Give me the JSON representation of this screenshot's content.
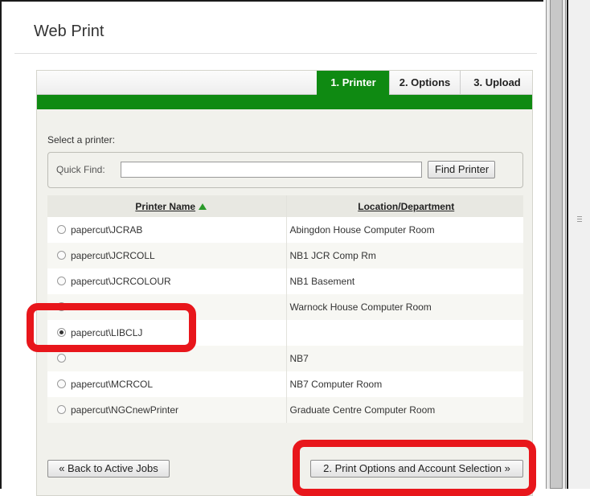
{
  "page": {
    "title": "Web Print"
  },
  "tabs": [
    {
      "label": "1. Printer",
      "active": true
    },
    {
      "label": "2. Options",
      "active": false
    },
    {
      "label": "3. Upload",
      "active": false
    }
  ],
  "colors": {
    "accent": "#0f8a12",
    "annotation": "#e8161b",
    "sort_arrow": "#2a9a2a"
  },
  "select_label": "Select a printer:",
  "quick_find": {
    "label": "Quick Find:",
    "value": "",
    "placeholder": "",
    "button_label": "Find Printer"
  },
  "table": {
    "headers": {
      "name": "Printer Name",
      "location": "Location/Department"
    },
    "sort_icon": "sort-ascending-icon",
    "rows": [
      {
        "name": "papercut\\JCRAB",
        "location": "Abingdon House Computer Room",
        "selected": false
      },
      {
        "name": "papercut\\JCRCOLL",
        "location": "NB1 JCR Comp Rm",
        "selected": false
      },
      {
        "name": "papercut\\JCRCOLOUR",
        "location": "NB1 Basement",
        "selected": false
      },
      {
        "name": "",
        "location": "Warnock House Computer Room",
        "selected": false
      },
      {
        "name": "papercut\\LIBCLJ",
        "location": "",
        "selected": true
      },
      {
        "name": "",
        "location": "NB7",
        "selected": false
      },
      {
        "name": "papercut\\MCRCOL",
        "location": "NB7 Computer Room",
        "selected": false
      },
      {
        "name": "papercut\\NGCnewPrinter",
        "location": "Graduate Centre Computer Room",
        "selected": false
      }
    ]
  },
  "buttons": {
    "back": "« Back to Active Jobs",
    "next": "2. Print Options and Account Selection »"
  }
}
